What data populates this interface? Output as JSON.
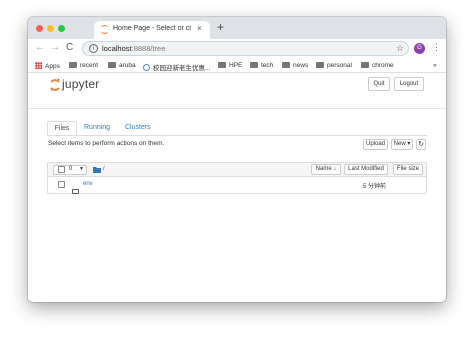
{
  "browser": {
    "tab_title": "Home Page - Select or create",
    "tab_close": "×",
    "new_tab": "+",
    "url_host": "localhost",
    "url_path": ":8888/tree",
    "avatar_letter": "G",
    "colors": {
      "traffic_red": "#ff5f57",
      "traffic_yellow": "#febc2e",
      "traffic_green": "#28c840"
    }
  },
  "bookmarks": {
    "apps": "Apps",
    "items": [
      "recent",
      "aruba",
      "校园迎新老生优惠...",
      "HPE",
      "tech",
      "news",
      "personal",
      "chrome"
    ],
    "overflow": "»"
  },
  "jupyter": {
    "logo_text": "jupyter",
    "quit": "Quit",
    "logout": "Logout",
    "tabs": [
      "Files",
      "Running",
      "Clusters"
    ],
    "instruction": "Select items to perform actions on them.",
    "upload": "Upload",
    "new": "New ▾",
    "refresh": "↻",
    "selected_count": "0",
    "breadcrumb": "/",
    "sort_name": "Name ↓",
    "last_modified": "Last Modified",
    "file_size": "File size",
    "rows": [
      {
        "name": "env",
        "modified": "5 分钟前"
      }
    ]
  }
}
